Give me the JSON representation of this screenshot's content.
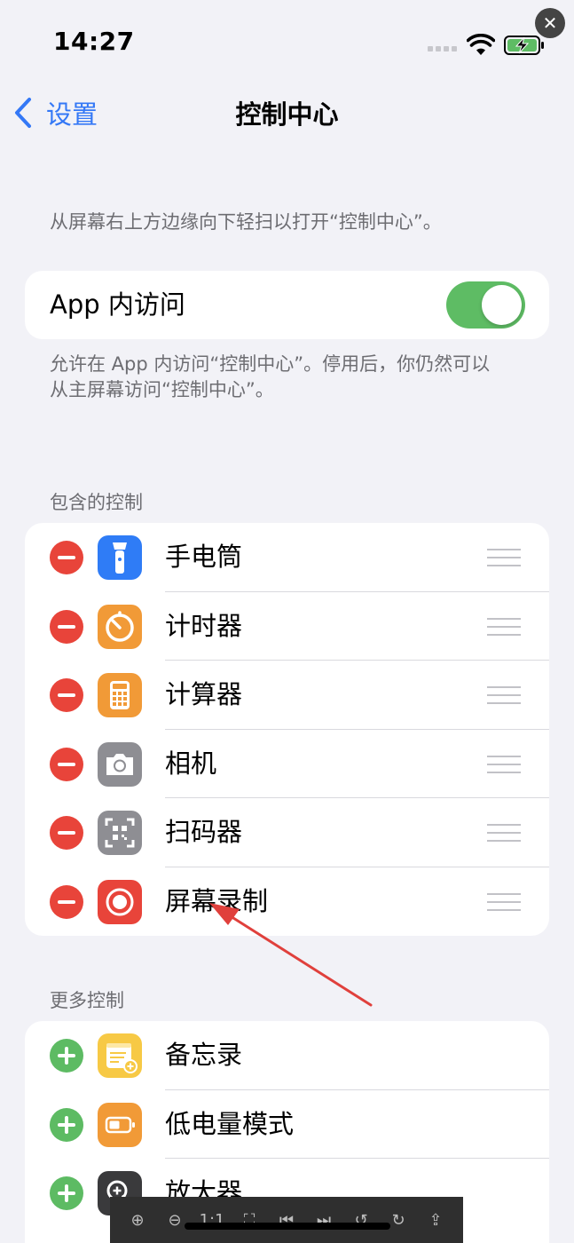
{
  "status_bar": {
    "time": "14:27"
  },
  "nav": {
    "back_label": "设置",
    "title": "控制中心"
  },
  "intro_text": "从屏幕右上方边缘向下轻扫以打开“控制中心”。",
  "app_access": {
    "label": "App 内访问",
    "enabled": true,
    "footnote_line1": "允许在 App 内访问“控制中心”。停用后，你仍然可以",
    "footnote_line2": "从主屏幕访问“控制中心”。"
  },
  "included": {
    "header": "包含的控制",
    "items": [
      {
        "label": "手电筒",
        "icon": "flashlight-icon",
        "color": "#2f7cf6"
      },
      {
        "label": "计时器",
        "icon": "timer-icon",
        "color": "#f19a37"
      },
      {
        "label": "计算器",
        "icon": "calculator-icon",
        "color": "#f19a37"
      },
      {
        "label": "相机",
        "icon": "camera-icon",
        "color": "#8e8e93"
      },
      {
        "label": "扫码器",
        "icon": "qr-scanner-icon",
        "color": "#8e8e93"
      },
      {
        "label": "屏幕录制",
        "icon": "screen-record-icon",
        "color": "#e8443a"
      }
    ]
  },
  "more": {
    "header": "更多控制",
    "items": [
      {
        "label": "备忘录",
        "icon": "notes-icon",
        "color": "#f7c945"
      },
      {
        "label": "低电量模式",
        "icon": "low-power-icon",
        "color": "#f19a37"
      },
      {
        "label": "放大器",
        "icon": "magnifier-icon",
        "color": "#3a3a3c"
      }
    ]
  },
  "viewer_toolbar": {
    "zoom_in": "⊕",
    "zoom_out": "⊖",
    "actual_size": "1:1",
    "fit": "⛶",
    "prev": "⏮",
    "next": "⏭",
    "rotate_left": "↺",
    "rotate_right": "↻",
    "share": "⇪"
  },
  "colors": {
    "accent": "#3478f6",
    "toggle_on": "#5ebc64",
    "remove": "#e8443a",
    "add": "#5dbb63",
    "annotation_arrow": "#e0403c"
  }
}
